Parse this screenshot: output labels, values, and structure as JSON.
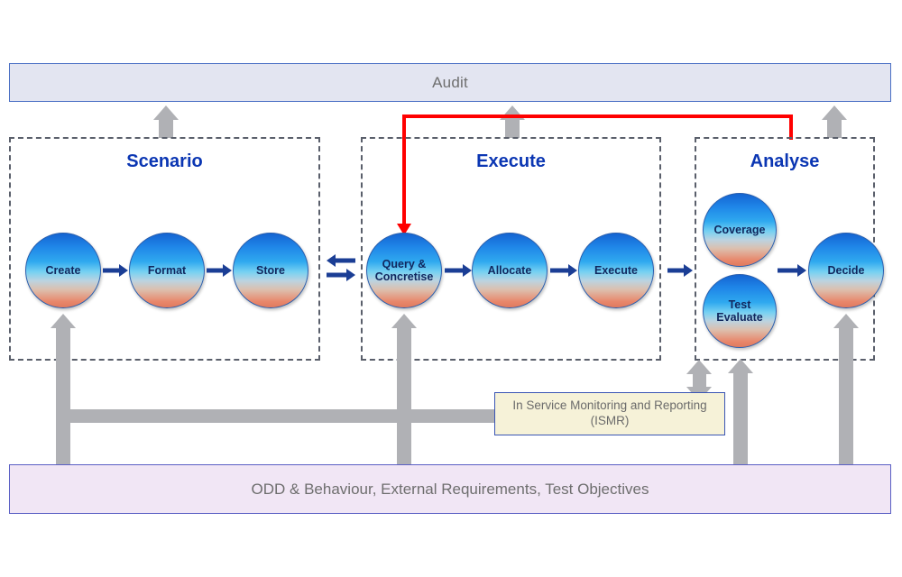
{
  "audit": {
    "label": "Audit"
  },
  "phases": [
    {
      "id": "scenario",
      "title": "Scenario"
    },
    {
      "id": "execute",
      "title": "Execute"
    },
    {
      "id": "analyse",
      "title": "Analyse"
    }
  ],
  "nodes": {
    "create": "Create",
    "format": "Format",
    "store": "Store",
    "query": "Query &\nConcretise",
    "query_line1": "Query &",
    "query_line2": "Concretise",
    "allocate": "Allocate",
    "execute": "Execute",
    "coverage": "Coverage",
    "test_eval_line1": "Test",
    "test_eval_line2": "Evaluate",
    "decide": "Decide"
  },
  "ismr": {
    "line1": "In Service Monitoring and Reporting",
    "line2": "(ISMR)"
  },
  "requirements": {
    "label": "ODD & Behaviour, External Requirements, Test Objectives"
  },
  "colors": {
    "audit_fill": "#e3e5f1",
    "audit_border": "#4a6fc4",
    "phase_border": "#5a5f6b",
    "phase_title": "#0b36b3",
    "node_top": "#1464d2",
    "node_mid": "#77d1f2",
    "node_bottom": "#e07a5e",
    "node_text": "#10275e",
    "blue_arrow": "#1b3e95",
    "grey_arrow": "#b0b1b5",
    "red_feedback": "#ff0000",
    "ismr_fill": "#f6f2d8",
    "ismr_border": "#3a55b4",
    "bottom_fill": "#f1e6f5",
    "bottom_border": "#5a5fc4",
    "body_text": "#6e6e6e"
  }
}
